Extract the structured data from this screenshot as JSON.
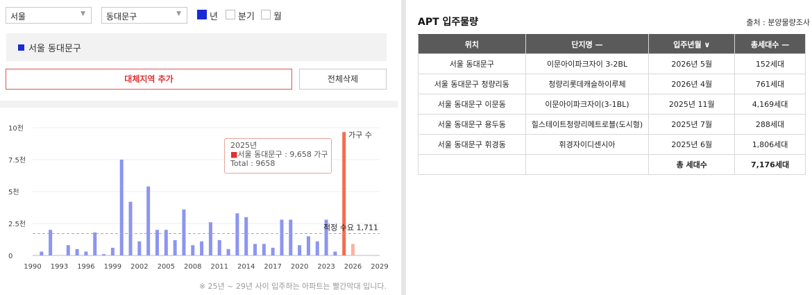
{
  "filters": {
    "city": "서울",
    "district": "동대문구",
    "periods": [
      {
        "label": "년",
        "checked": true
      },
      {
        "label": "분기",
        "checked": false
      },
      {
        "label": "월",
        "checked": false
      }
    ]
  },
  "selected_region": "서울 동대문구",
  "buttons": {
    "add_region": "대체지역 추가",
    "delete_all": "전체삭제"
  },
  "colors": {
    "accent": "#1a2bd6",
    "bar": "#8c95ef",
    "highlight_bar": "#f26d4f",
    "forecast_bar": "#f7b4a5",
    "demand_line": "#f08a8a"
  },
  "chart_data": {
    "type": "bar",
    "x_ticks": [
      "1990",
      "1993",
      "1996",
      "1999",
      "2002",
      "2005",
      "2008",
      "2011",
      "2014",
      "2017",
      "2020",
      "2023",
      "2026",
      "2029"
    ],
    "y_ticks": [
      "0",
      "2.5천",
      "5천",
      "7.5천",
      "10천"
    ],
    "ylim": [
      0,
      10000
    ],
    "xlim": [
      1990,
      2029
    ],
    "series": [
      {
        "name": "가구 수",
        "points": [
          {
            "x": 1991,
            "y": 300
          },
          {
            "x": 1992,
            "y": 2000
          },
          {
            "x": 1994,
            "y": 800
          },
          {
            "x": 1995,
            "y": 500
          },
          {
            "x": 1996,
            "y": 300
          },
          {
            "x": 1997,
            "y": 1800
          },
          {
            "x": 1998,
            "y": 100
          },
          {
            "x": 1999,
            "y": 600
          },
          {
            "x": 2000,
            "y": 7500
          },
          {
            "x": 2001,
            "y": 4200
          },
          {
            "x": 2002,
            "y": 1100
          },
          {
            "x": 2003,
            "y": 5400
          },
          {
            "x": 2004,
            "y": 2000
          },
          {
            "x": 2005,
            "y": 2000
          },
          {
            "x": 2006,
            "y": 1200
          },
          {
            "x": 2007,
            "y": 3600
          },
          {
            "x": 2008,
            "y": 800
          },
          {
            "x": 2009,
            "y": 1100
          },
          {
            "x": 2010,
            "y": 2600
          },
          {
            "x": 2011,
            "y": 1200
          },
          {
            "x": 2012,
            "y": 500
          },
          {
            "x": 2013,
            "y": 3300
          },
          {
            "x": 2014,
            "y": 3000
          },
          {
            "x": 2015,
            "y": 900
          },
          {
            "x": 2016,
            "y": 900
          },
          {
            "x": 2017,
            "y": 600
          },
          {
            "x": 2018,
            "y": 2800
          },
          {
            "x": 2019,
            "y": 2800
          },
          {
            "x": 2020,
            "y": 800
          },
          {
            "x": 2021,
            "y": 1500
          },
          {
            "x": 2022,
            "y": 1100
          },
          {
            "x": 2023,
            "y": 2800
          },
          {
            "x": 2024,
            "y": 300
          },
          {
            "x": 2025,
            "y": 9658,
            "highlight": true
          },
          {
            "x": 2026,
            "y": 900,
            "forecast": true
          }
        ]
      }
    ],
    "demand_line": {
      "value": 1711,
      "label": "적정 수요 1,711"
    },
    "tooltip": {
      "year": "2025년",
      "series_line": "서울 동대문구 : 9,658 가구",
      "total_line": "Total : 9658"
    }
  },
  "chart_note": "※ 25년 ~ 29년 사이 입주하는 아파트는 빨간막대 입니다.",
  "apt": {
    "title": "APT 입주물량",
    "source": "출처 : 분양물량조사",
    "columns": [
      "위치",
      "단지명 —",
      "입주년월 ∨",
      "총세대수 —"
    ],
    "rows": [
      [
        "서울 동대문구",
        "이문아이파크자이 3-2BL",
        "2026년 5월",
        "152세대"
      ],
      [
        "서울 동대문구 청량리동",
        "청량리롯데캐슬하이루체",
        "2026년 4월",
        "761세대"
      ],
      [
        "서울 동대문구 이문동",
        "이문아이파크자이(3-1BL)",
        "2025년 11월",
        "4,169세대"
      ],
      [
        "서울 동대문구 용두동",
        "힐스테이트청량리메트로블(도시형)",
        "2025년 7월",
        "288세대"
      ],
      [
        "서울 동대문구 휘경동",
        "휘경자이디센시아",
        "2025년 6월",
        "1,806세대"
      ]
    ],
    "total_label": "총 세대수",
    "total_value": "7,176세대"
  }
}
